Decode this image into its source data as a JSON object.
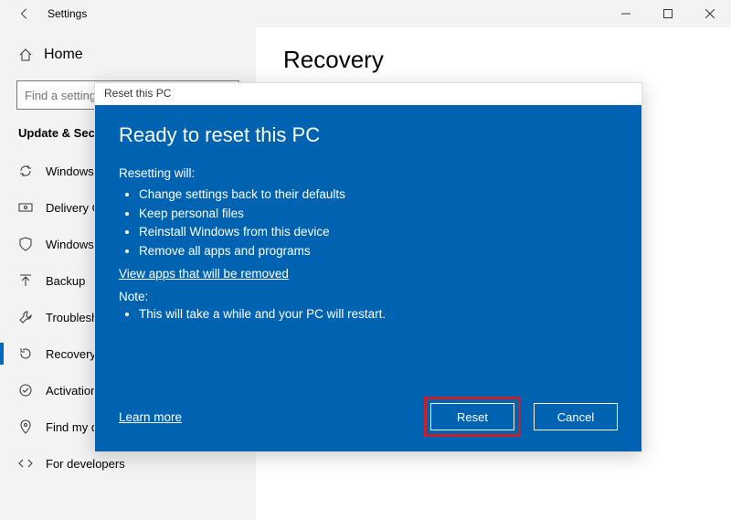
{
  "titlebar": {
    "title": "Settings"
  },
  "sidebar": {
    "home": "Home",
    "search_placeholder": "Find a setting",
    "category": "Update & Security",
    "items": [
      {
        "label": "Windows Update"
      },
      {
        "label": "Delivery Optimization"
      },
      {
        "label": "Windows Security"
      },
      {
        "label": "Backup"
      },
      {
        "label": "Troubleshoot"
      },
      {
        "label": "Recovery"
      },
      {
        "label": "Activation"
      },
      {
        "label": "Find my device"
      },
      {
        "label": "For developers"
      }
    ]
  },
  "main": {
    "page_title": "Recovery"
  },
  "modal": {
    "title": "Reset this PC",
    "heading": "Ready to reset this PC",
    "resetting_label": "Resetting will:",
    "bullets": [
      "Change settings back to their defaults",
      "Keep personal files",
      "Reinstall Windows from this device",
      "Remove all apps and programs"
    ],
    "view_apps_link": "View apps that will be removed",
    "note_label": "Note:",
    "note_bullets": [
      "This will take a while and your PC will restart."
    ],
    "learn_more": "Learn more",
    "reset_btn": "Reset",
    "cancel_btn": "Cancel"
  }
}
